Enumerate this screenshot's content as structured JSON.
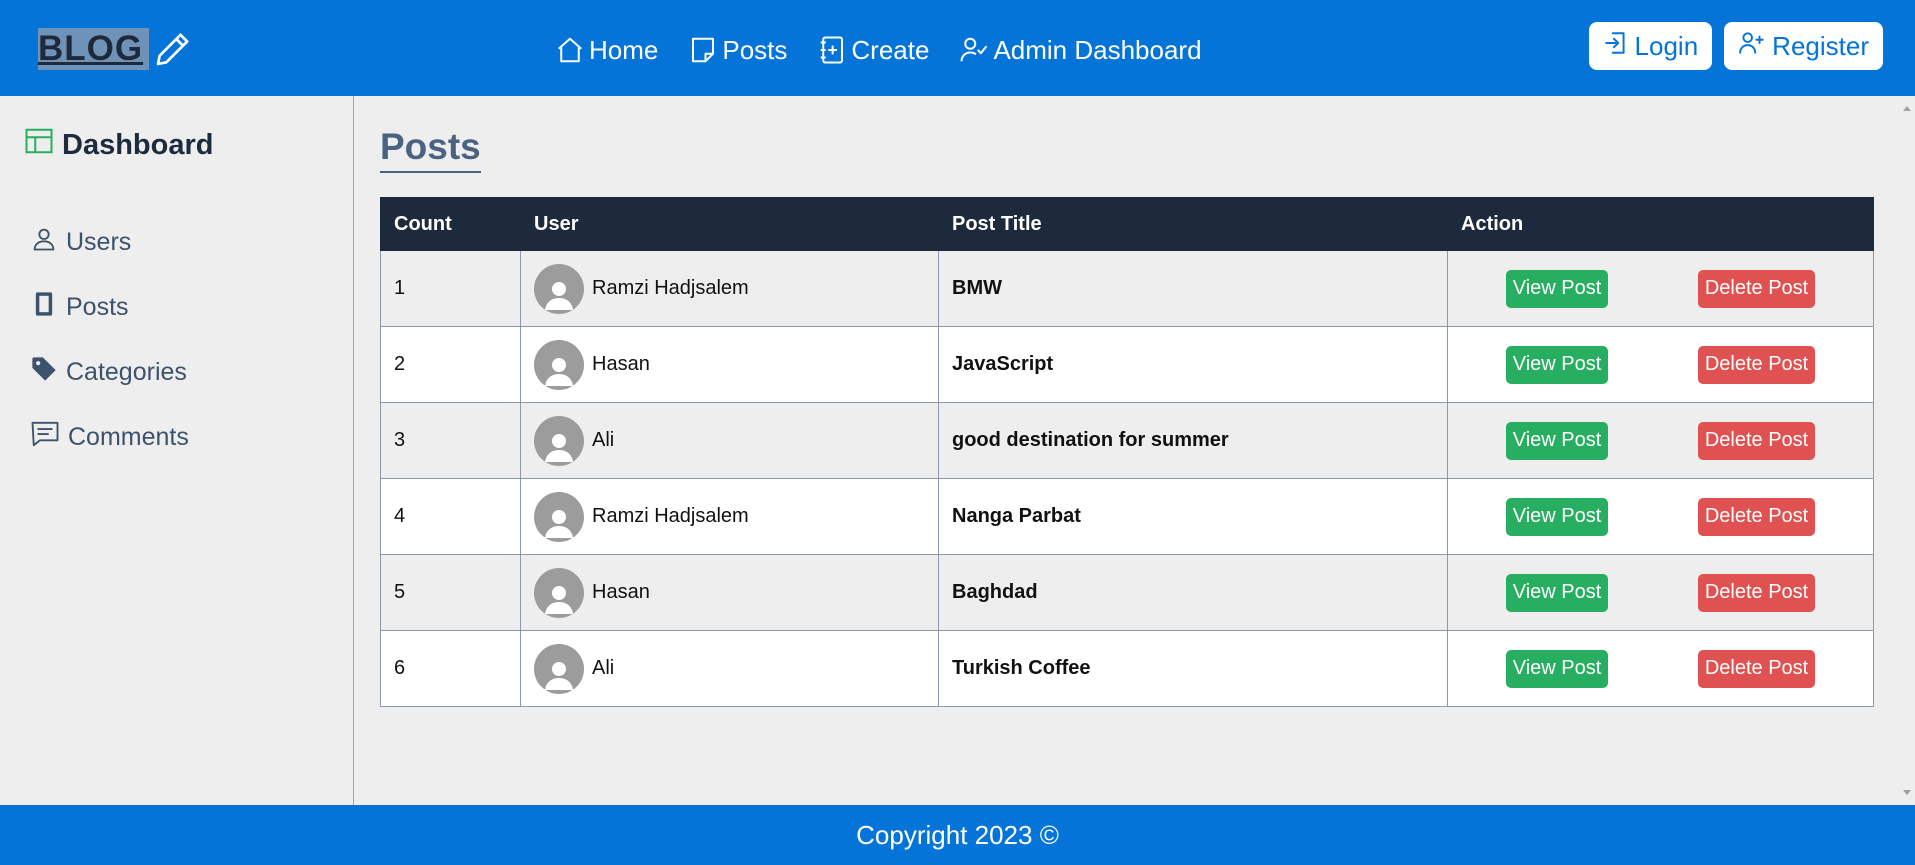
{
  "header": {
    "logo_text": "BLOG",
    "nav": [
      {
        "label": "Home",
        "icon": "home-icon"
      },
      {
        "label": "Posts",
        "icon": "posts-icon"
      },
      {
        "label": "Create",
        "icon": "create-icon"
      },
      {
        "label": "Admin Dashboard",
        "icon": "admin-icon"
      }
    ],
    "login_label": "Login",
    "register_label": "Register"
  },
  "sidebar": {
    "title": "Dashboard",
    "items": [
      {
        "label": "Users",
        "icon": "user-icon"
      },
      {
        "label": "Posts",
        "icon": "posts-icon"
      },
      {
        "label": "Categories",
        "icon": "tag-icon"
      },
      {
        "label": "Comments",
        "icon": "comment-icon"
      }
    ]
  },
  "main": {
    "title": "Posts",
    "columns": [
      "Count",
      "User",
      "Post Title",
      "Action"
    ],
    "rows": [
      {
        "count": "1",
        "user": "Ramzi Hadjsalem",
        "title": "BMW"
      },
      {
        "count": "2",
        "user": "Hasan",
        "title": "JavaScript"
      },
      {
        "count": "3",
        "user": "Ali",
        "title": "good destination for summer"
      },
      {
        "count": "4",
        "user": "Ramzi Hadjsalem",
        "title": "Nanga Parbat"
      },
      {
        "count": "5",
        "user": "Hasan",
        "title": "Baghdad"
      },
      {
        "count": "6",
        "user": "Ali",
        "title": "Turkish Coffee"
      }
    ],
    "view_label": "View Post",
    "delete_label": "Delete Post"
  },
  "footer": {
    "text": "Copyright 2023 ©"
  },
  "colors": {
    "header_bg": "#0474d8",
    "table_header_bg": "#1d2a3c",
    "view_button": "#27ae60",
    "delete_button": "#e05252",
    "avatar": "#9c9c9c"
  }
}
